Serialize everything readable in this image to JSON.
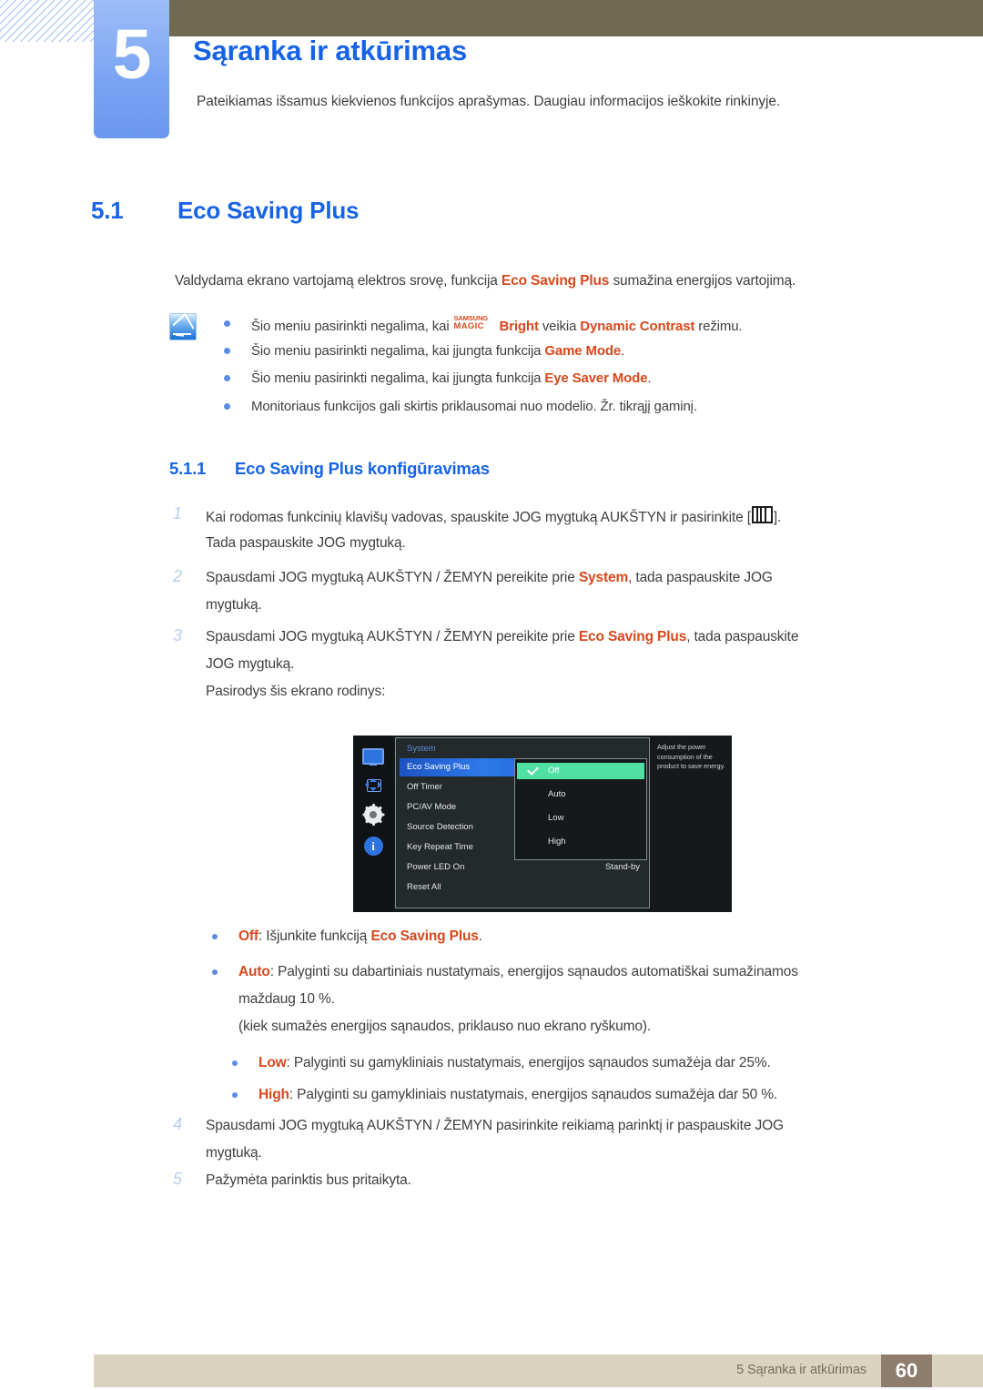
{
  "chapter": {
    "number": "5",
    "title": "Sąranka ir atkūrimas",
    "subtitle": "Pateikiamas išsamus kiekvienos funkcijos aprašymas. Daugiau informacijos ieškokite rinkinyje."
  },
  "section": {
    "number": "5.1",
    "title": "Eco Saving Plus",
    "intro_before": "Valdydama ekrano vartojamą elektros srovę, funkcija ",
    "intro_highlight": "Eco Saving Plus",
    "intro_after": " sumažina energijos vartojimą."
  },
  "notes": [
    {
      "before": "Šio meniu pasirinkti negalima, kai ",
      "magic_top": "SAMSUNG",
      "magic_bottom": "MAGIC",
      "magic_word": "Bright",
      "middle": " veikia ",
      "highlight": "Dynamic Contrast",
      "after": " režimu."
    },
    {
      "before": "Šio meniu pasirinkti negalima, kai įjungta funkcija ",
      "highlight": "Game Mode",
      "after": "."
    },
    {
      "before": "Šio meniu pasirinkti negalima, kai įjungta funkcija ",
      "highlight": "Eye Saver Mode",
      "after": "."
    },
    {
      "before": "Monitoriaus funkcijos gali skirtis priklausomai nuo modelio. Žr. tikrąjį gaminį.",
      "highlight": "",
      "after": ""
    }
  ],
  "subsection": {
    "number": "5.1.1",
    "title": "Eco Saving Plus konfigūravimas"
  },
  "steps": [
    {
      "num": "1",
      "line1_before": "Kai rodomas funkcinių klavišų vadovas, spauskite JOG mygtuką AUKŠTYN ir pasirinkite [",
      "line1_after": "].",
      "line2": "Tada paspauskite JOG mygtuką."
    },
    {
      "num": "2",
      "line1_before": "Spausdami JOG mygtuką AUKŠTYN / ŽEMYN pereikite prie ",
      "line1_highlight": "System",
      "line1_after": ", tada paspauskite JOG",
      "line2": "mygtuką."
    },
    {
      "num": "3",
      "line1_before": "Spausdami JOG mygtuką AUKŠTYN / ŽEMYN pereikite prie ",
      "line1_highlight": "Eco Saving Plus",
      "line1_after": ", tada paspauskite",
      "line2": "JOG mygtuką.",
      "line3": "Pasirodys šis ekrano rodinys:"
    },
    {
      "num": "4",
      "line1_before": "Spausdami JOG mygtuką AUKŠTYN / ŽEMYN pasirinkite reikiamą parinktį ir paspauskite JOG",
      "line2": "mygtuką."
    },
    {
      "num": "5",
      "line1_before": "Pažymėta parinktis bus pritaikyta."
    }
  ],
  "osd": {
    "title": "System",
    "menu_items": [
      {
        "label": "Eco Saving Plus",
        "value": "",
        "selected": true
      },
      {
        "label": "Off Timer",
        "value": "",
        "selected": false
      },
      {
        "label": "PC/AV Mode",
        "value": "",
        "selected": false
      },
      {
        "label": "Source Detection",
        "value": "",
        "selected": false
      },
      {
        "label": "Key Repeat Time",
        "value": "",
        "selected": false
      },
      {
        "label": "Power LED On",
        "value": "Stand-by",
        "selected": false
      },
      {
        "label": "Reset All",
        "value": "",
        "selected": false
      }
    ],
    "options": [
      {
        "label": "Off",
        "checked": true
      },
      {
        "label": "Auto",
        "checked": false
      },
      {
        "label": "Low",
        "checked": false
      },
      {
        "label": "High",
        "checked": false
      }
    ],
    "help_text": "Adjust the power consumption of the product to save energy.",
    "icons": [
      "monitor-icon",
      "position-arrows-icon",
      "gear-icon",
      "info-icon"
    ],
    "colors": {
      "selected_row": "#2f7ae8",
      "selected_option": "#4fe0a4",
      "title": "#5b8ddb"
    }
  },
  "options_list": [
    {
      "term": "Off",
      "before": ": Išjunkite funkciją ",
      "highlight": "Eco Saving Plus",
      "after": ".",
      "extra": [],
      "indent": 0
    },
    {
      "term": "Auto",
      "before": ": Palyginti su dabartiniais nustatymais, energijos sąnaudos automatiškai sumažinamos",
      "highlight": "",
      "after": "",
      "extra": [
        "maždaug 10 %.",
        "(kiek sumažės energijos sąnaudos, priklauso nuo ekrano ryškumo)."
      ],
      "indent": 0
    },
    {
      "term": "Low",
      "before": ": Palyginti su gamykliniais nustatymais, energijos sąnaudos sumažėja dar 25%.",
      "highlight": "",
      "after": "",
      "extra": [],
      "indent": 1
    },
    {
      "term": "High",
      "before": ": Palyginti su gamykliniais nustatymais, energijos sąnaudos sumažėja dar 50 %.",
      "highlight": "",
      "after": "",
      "extra": [],
      "indent": 1
    }
  ],
  "footer": {
    "text": "5 Sąranka ir atkūrimas",
    "page": "60"
  }
}
